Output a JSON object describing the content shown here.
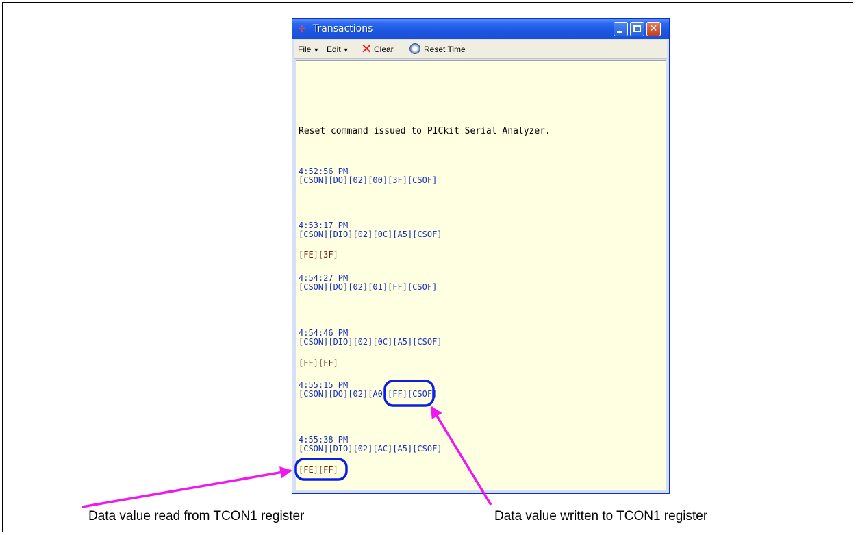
{
  "window": {
    "title": "Transactions",
    "controls": {
      "minimize": "minimize",
      "maximize": "maximize",
      "close": "close"
    }
  },
  "toolbar": {
    "file_label": "File",
    "edit_label": "Edit",
    "clear_label": "Clear",
    "reset_time_label": "Reset Time"
  },
  "log": {
    "reset_message": "Reset command issued to PICkit Serial Analyzer.",
    "entries": [
      {
        "time": "4:52:56 PM",
        "command": "[CSON][DO][02][00][3F][CSOF]",
        "response": ""
      },
      {
        "time": "4:53:17 PM",
        "command": "[CSON][DIO][02][0C][A5][CSOF]",
        "response": "[FE][3F]"
      },
      {
        "time": "4:54:27 PM",
        "command": "[CSON][DO][02][01][FF][CSOF]",
        "response": ""
      },
      {
        "time": "4:54:46 PM",
        "command": "[CSON][DIO][02][0C][A5][CSOF]",
        "response": "[FF][FF]"
      },
      {
        "time": "4:55:15 PM",
        "command": "[CSON][DO][02][A0][FF][CSOF]",
        "response": ""
      },
      {
        "time": "4:55:38 PM",
        "command": "[CSON][DIO][02][AC][A5][CSOF]",
        "response": "[FE][FF]"
      }
    ]
  },
  "annotations": {
    "read_label": "Data value read from TCON1 register",
    "written_label": "Data value written to TCON1 register"
  },
  "colors": {
    "highlight": "#0a1ee6",
    "arrow": "#f018f0",
    "log_background": "#ffffe1",
    "command_text": "#1a2fc0",
    "response_text": "#6a1a10"
  },
  "icons": {
    "app": "transactions-app-icon",
    "clear": "red-x-icon",
    "reset_time": "clock-reset-icon"
  }
}
